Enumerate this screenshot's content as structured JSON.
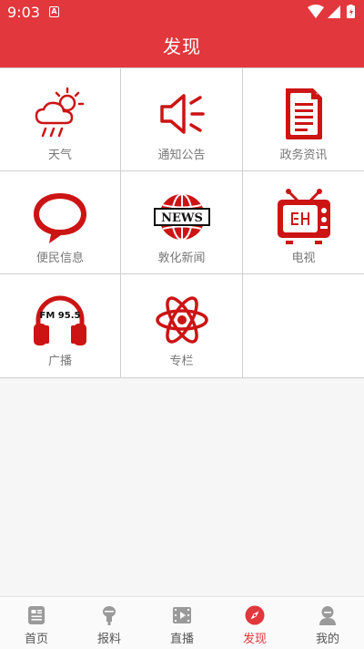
{
  "status": {
    "time": "9:03",
    "notif_glyph": "A"
  },
  "header": {
    "title": "发现"
  },
  "grid": {
    "items": [
      {
        "label": "天气",
        "icon": "weather-icon"
      },
      {
        "label": "通知公告",
        "icon": "speaker-icon"
      },
      {
        "label": "政务资讯",
        "icon": "document-icon"
      },
      {
        "label": "便民信息",
        "icon": "chat-bubble-icon"
      },
      {
        "label": "敦化新闻",
        "icon": "news-globe-icon",
        "badge": "NEWS"
      },
      {
        "label": "电视",
        "icon": "tv-icon"
      },
      {
        "label": "广播",
        "icon": "headphones-icon",
        "badge": "FM 95.5"
      },
      {
        "label": "专栏",
        "icon": "atom-icon"
      }
    ]
  },
  "tabbar": {
    "items": [
      {
        "label": "首页",
        "icon": "home-icon"
      },
      {
        "label": "报料",
        "icon": "microphone-icon"
      },
      {
        "label": "直播",
        "icon": "video-icon"
      },
      {
        "label": "发现",
        "icon": "compass-icon",
        "active": true
      },
      {
        "label": "我的",
        "icon": "user-icon"
      }
    ]
  },
  "colors": {
    "accent": "#e2373c",
    "icon_red": "#cc1414",
    "tab_gray": "#9a9a9a"
  }
}
